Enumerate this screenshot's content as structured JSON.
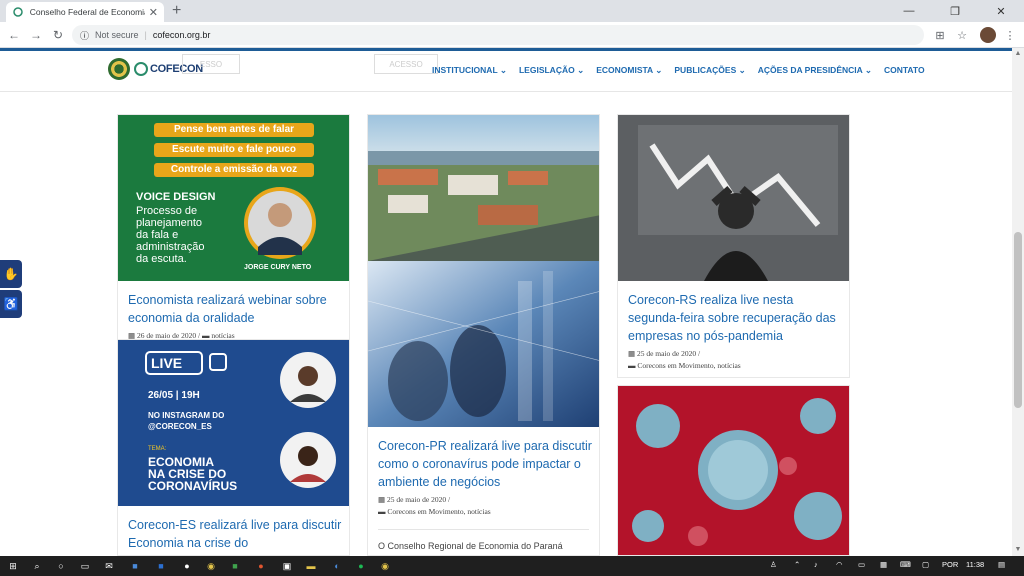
{
  "browser": {
    "tab_title": "Conselho Federal de Economia -",
    "new_tab": "+",
    "security_label": "Not secure",
    "url": "cofecon.org.br"
  },
  "site": {
    "logo_text": "COFECON",
    "ghost_buttons": [
      "ESSO",
      "ACESSO"
    ],
    "menu": [
      {
        "label": "INSTITUCIONAL"
      },
      {
        "label": "LEGISLAÇÃO"
      },
      {
        "label": "ECONOMISTA"
      },
      {
        "label": "PUBLICAÇÕES"
      },
      {
        "label": "AÇÕES DA PRESIDÊNCIA"
      },
      {
        "label": "CONTATO"
      }
    ]
  },
  "cards": {
    "voice": {
      "banner_lines": [
        "Pense bem antes de falar",
        "Escute muito e fale pouco",
        "Controle a emissão da voz"
      ],
      "heading": "VOICE DESIGN",
      "body": [
        "Processo de",
        "planejamento",
        "da fala e",
        "administração",
        "da escuta."
      ],
      "person": "JORGE CURY NETO",
      "title": "Economista realizará webinar sobre economia da oralidade",
      "date": "26 de maio de 2020",
      "category": "notícias"
    },
    "es": {
      "live": "LIVE",
      "when": "26/05 | 19H",
      "where": [
        "NO INSTAGRAM DO",
        "@CORECON_ES"
      ],
      "tema": "TEMA:",
      "topic": [
        "ECONOMIA",
        "NA CRISE DO",
        "CORONAVÍRUS"
      ],
      "title": "Corecon-ES realizará live para discutir Economia na crise do"
    },
    "pr": {
      "title": "Corecon-PR realizará live para discutir como o coronavírus pode impactar o ambiente de negócios",
      "date": "25 de maio de 2020",
      "category": "Corecons em Movimento, notícias",
      "excerpt": "O Conselho Regional de Economia do Paraná"
    },
    "rs": {
      "title": "Corecon-RS realiza live nesta segunda-feira sobre recuperação das empresas no pós-pandemia",
      "date": "25 de maio de 2020",
      "category": "Corecons em Movimento, notícias"
    }
  },
  "taskbar": {
    "language": "POR",
    "time": "11:38"
  }
}
